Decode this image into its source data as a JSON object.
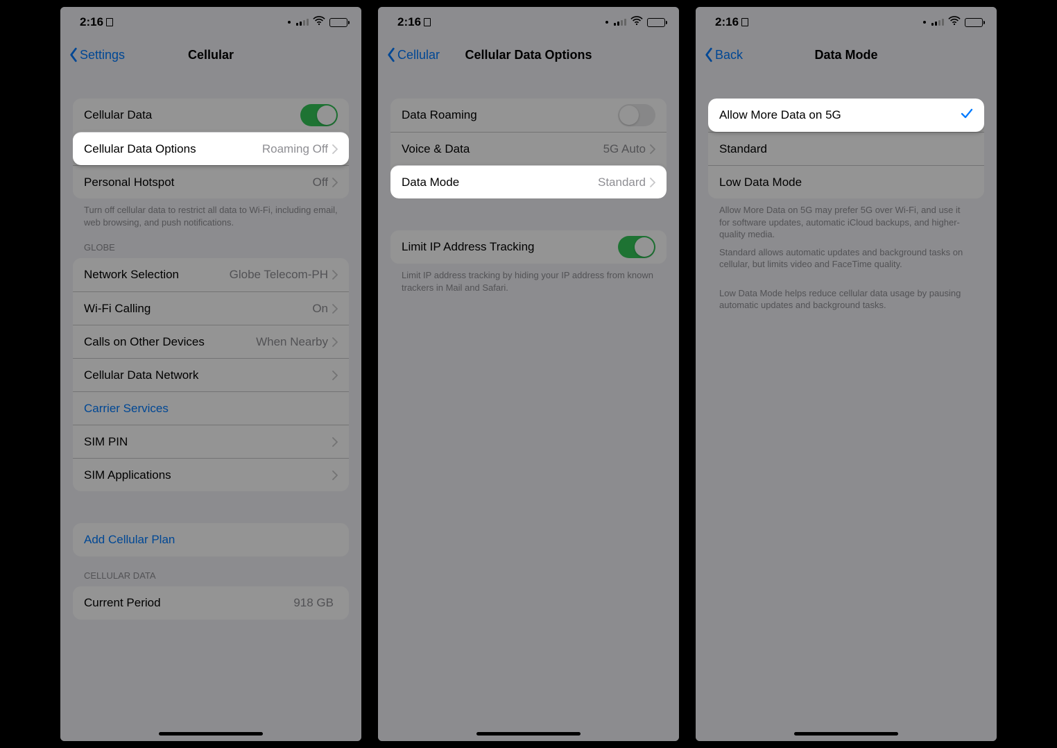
{
  "status": {
    "time": "2:16"
  },
  "screen1": {
    "back_label": "Settings",
    "title": "Cellular",
    "rows": {
      "cellular_data": "Cellular Data",
      "cdo_label": "Cellular Data Options",
      "cdo_value": "Roaming Off",
      "hotspot_label": "Personal Hotspot",
      "hotspot_value": "Off"
    },
    "footer1": "Turn off cellular data to restrict all data to Wi-Fi, including email, web browsing, and push notifications.",
    "section_globe": "GLOBE",
    "globe": {
      "netsel_label": "Network Selection",
      "netsel_value": "Globe Telecom-PH",
      "wificall_label": "Wi-Fi Calling",
      "wificall_value": "On",
      "cod_label": "Calls on Other Devices",
      "cod_value": "When Nearby",
      "cdn_label": "Cellular Data Network",
      "carrier_label": "Carrier Services",
      "simpin_label": "SIM PIN",
      "simapps_label": "SIM Applications"
    },
    "add_plan": "Add Cellular Plan",
    "section_cd": "CELLULAR DATA",
    "current_period_label": "Current Period",
    "current_period_value": "918 GB"
  },
  "screen2": {
    "back_label": "Cellular",
    "title": "Cellular Data Options",
    "rows": {
      "roaming": "Data Roaming",
      "vd_label": "Voice & Data",
      "vd_value": "5G Auto",
      "dm_label": "Data Mode",
      "dm_value": "Standard",
      "limit_ip": "Limit IP Address Tracking"
    },
    "footer": "Limit IP address tracking by hiding your IP address from known trackers in Mail and Safari."
  },
  "screen3": {
    "back_label": "Back",
    "title": "Data Mode",
    "options": {
      "allow_5g": "Allow More Data on 5G",
      "standard": "Standard",
      "low": "Low Data Mode"
    },
    "footer_a": "Allow More Data on 5G may prefer 5G over Wi-Fi, and use it for software updates, automatic iCloud backups, and higher-quality media.",
    "footer_b": "Standard allows automatic updates and background tasks on cellular, but limits video and FaceTime quality.",
    "footer_c": "Low Data Mode helps reduce cellular data usage by pausing automatic updates and background tasks."
  }
}
